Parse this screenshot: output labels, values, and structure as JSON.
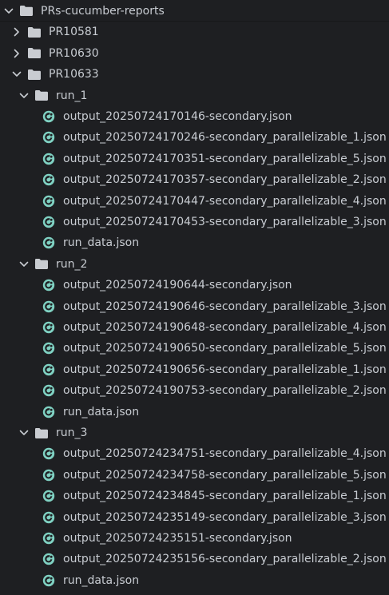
{
  "tree": {
    "root": {
      "label": "PRs-cucumber-reports",
      "expanded": true
    },
    "folders": [
      {
        "label": "PR10581",
        "expanded": false
      },
      {
        "label": "PR10630",
        "expanded": false
      },
      {
        "label": "PR10633",
        "expanded": true
      }
    ],
    "runs": [
      {
        "label": "run_1",
        "expanded": true,
        "files": [
          "output_20250724170146-secondary.json",
          "output_20250724170246-secondary_parallelizable_1.json",
          "output_20250724170351-secondary_parallelizable_5.json",
          "output_20250724170357-secondary_parallelizable_2.json",
          "output_20250724170447-secondary_parallelizable_4.json",
          "output_20250724170453-secondary_parallelizable_3.json",
          "run_data.json"
        ]
      },
      {
        "label": "run_2",
        "expanded": true,
        "files": [
          "output_20250724190644-secondary.json",
          "output_20250724190646-secondary_parallelizable_3.json",
          "output_20250724190648-secondary_parallelizable_4.json",
          "output_20250724190650-secondary_parallelizable_5.json",
          "output_20250724190656-secondary_parallelizable_1.json",
          "output_20250724190753-secondary_parallelizable_2.json",
          "run_data.json"
        ]
      },
      {
        "label": "run_3",
        "expanded": true,
        "files": [
          "output_20250724234751-secondary_parallelizable_4.json",
          "output_20250724234758-secondary_parallelizable_5.json",
          "output_20250724234845-secondary_parallelizable_1.json",
          "output_20250724235149-secondary_parallelizable_3.json",
          "output_20250724235151-secondary.json",
          "output_20250724235156-secondary_parallelizable_2.json",
          "run_data.json"
        ]
      }
    ]
  },
  "icons": {
    "folder": "folder-icon",
    "file": "json-file-icon",
    "expanded": "chevron-down-icon",
    "collapsed": "chevron-right-icon"
  },
  "colors": {
    "background": "#1e1f22",
    "text": "#c8ccd2",
    "folder": "#c9ccd1",
    "chevron": "#c8ccd2",
    "file_icon_ring": "#7fd1c2",
    "file_icon_inner": "#1e1f22"
  }
}
